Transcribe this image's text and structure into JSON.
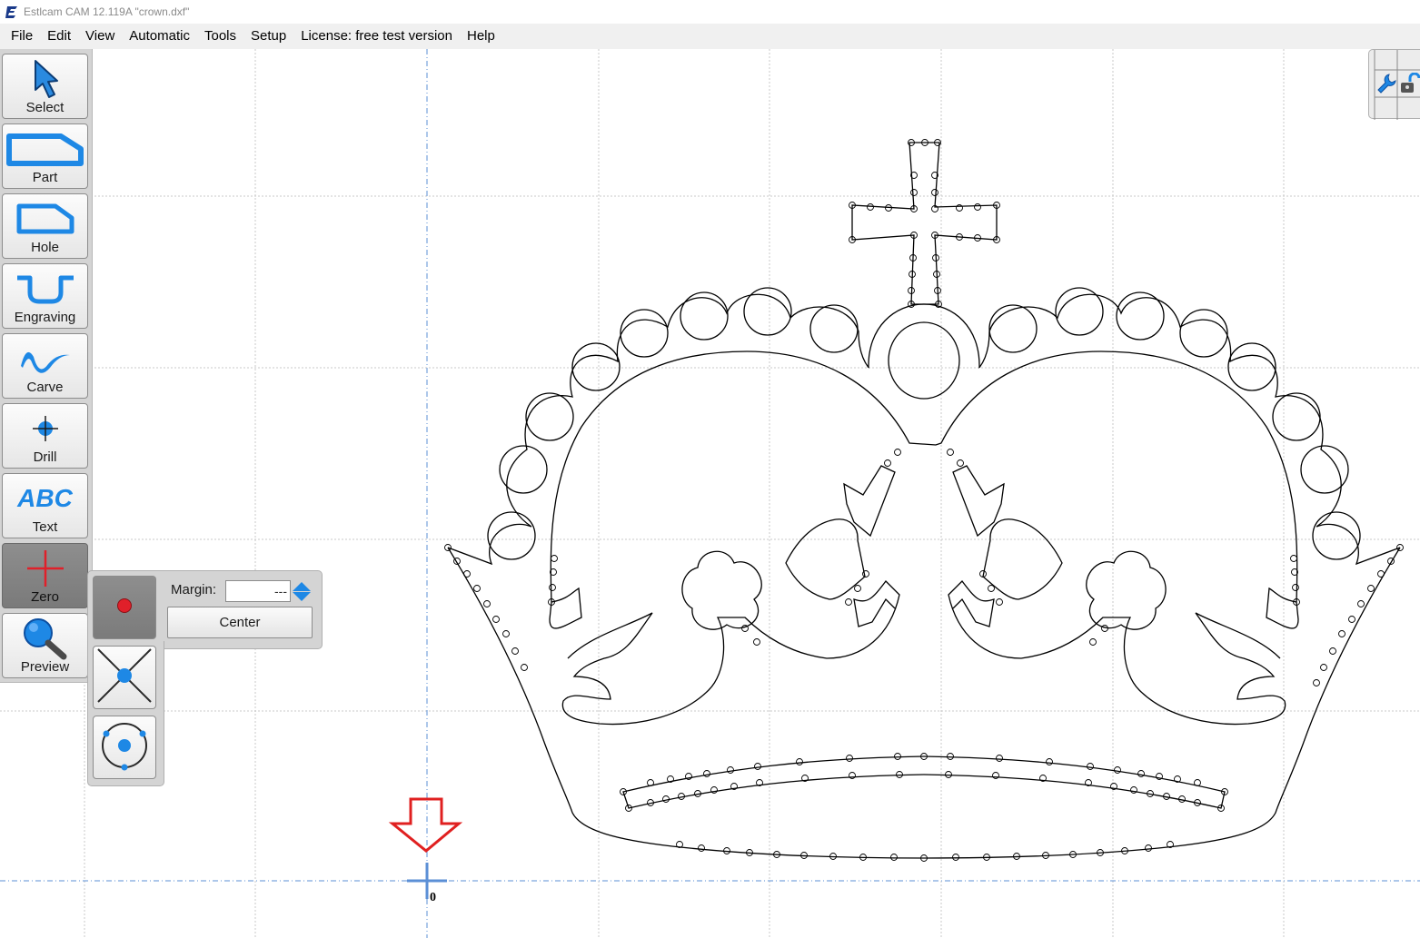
{
  "window": {
    "title": "Estlcam CAM 12.119A \"crown.dxf\""
  },
  "menu": [
    "File",
    "Edit",
    "View",
    "Automatic",
    "Tools",
    "Setup",
    "License: free test version",
    "Help"
  ],
  "toolbar": {
    "select": "Select",
    "part": "Part",
    "hole": "Hole",
    "engraving": "Engraving",
    "carve": "Carve",
    "drill": "Drill",
    "text": "Text",
    "text_icon": "ABC",
    "zero": "Zero",
    "preview": "Preview"
  },
  "zero_panel": {
    "margin_label": "Margin:",
    "margin_value": "---",
    "center_label": "Center"
  },
  "origin_label": "0",
  "colors": {
    "accent": "#1e88e5",
    "zero_red": "#e0202a",
    "arrow_red": "#e02020"
  }
}
